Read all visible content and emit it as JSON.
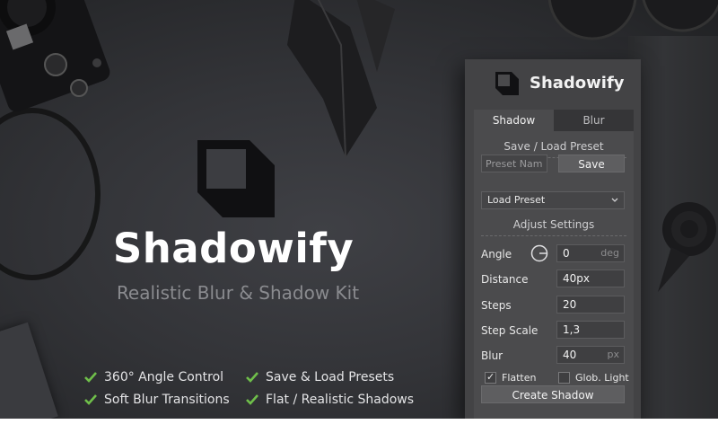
{
  "hero": {
    "title": "Shadowify",
    "subtitle": "Realistic Blur & Shadow Kit",
    "logo_icon": "shadow-square-icon"
  },
  "features": [
    "360° Angle Control",
    "Save & Load Presets",
    "Soft Blur Transitions",
    "Flat / Realistic Shadows"
  ],
  "panel": {
    "title": "Shadowify",
    "tabs": [
      "Shadow",
      "Blur"
    ],
    "active_tab": "Shadow",
    "preset_section": "Save / Load Preset",
    "preset_name_placeholder": "Preset Name",
    "save_label": "Save",
    "load_select_value": "Load Preset",
    "adjust_section": "Adjust Settings",
    "angle": {
      "label": "Angle",
      "value": "0",
      "unit": "deg"
    },
    "distance": {
      "label": "Distance",
      "value": "40px"
    },
    "steps": {
      "label": "Steps",
      "value": "20"
    },
    "step_scale": {
      "label": "Step Scale",
      "value": "1,3"
    },
    "blur": {
      "label": "Blur",
      "value": "40",
      "unit": "px"
    },
    "flatten": {
      "label": "Flatten",
      "checked": true
    },
    "glob_light": {
      "label": "Glob. Light",
      "checked": false
    },
    "create_label": "Create Shadow"
  },
  "colors": {
    "background": "#333438",
    "panel": "#434345",
    "panel_body": "#4b4b4d",
    "check_accent": "#6fbf4a",
    "text_light": "#ffffff",
    "subtitle": "#8a8b8f"
  }
}
